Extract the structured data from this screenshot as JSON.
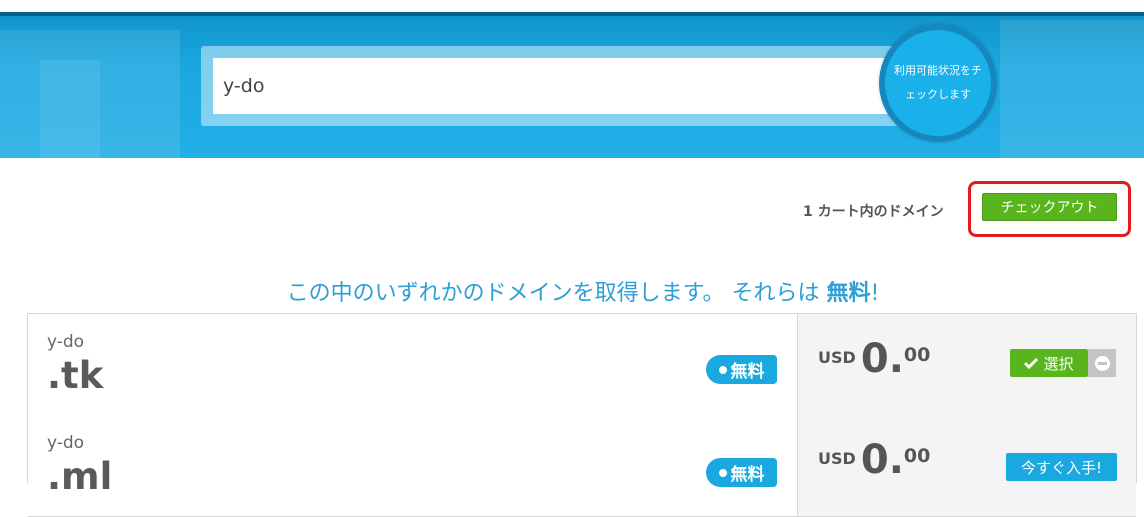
{
  "search": {
    "value": "y-do",
    "button_label": "利用可能状況をチェックします"
  },
  "cart": {
    "summary": "1 カート内のドメイン",
    "checkout_label": "チェックアウト"
  },
  "headline": {
    "prefix": "この中のいずれかのドメインを取得します。 それらは ",
    "emphasis": "無料",
    "suffix": "!"
  },
  "domains": [
    {
      "sld": "y-do",
      "tld": ".tk",
      "badge": "無料",
      "currency": "USD",
      "price_int": "0.",
      "price_dec": "00",
      "action": "選択",
      "state": "selected"
    },
    {
      "sld": "y-do",
      "tld": ".ml",
      "badge": "無料",
      "currency": "USD",
      "price_int": "0.",
      "price_dec": "00",
      "action": "今すぐ入手!",
      "state": "available"
    }
  ],
  "colors": {
    "accent_blue": "#1aa8e0",
    "accent_green": "#59b51e",
    "highlight_red": "#e31b1b"
  }
}
